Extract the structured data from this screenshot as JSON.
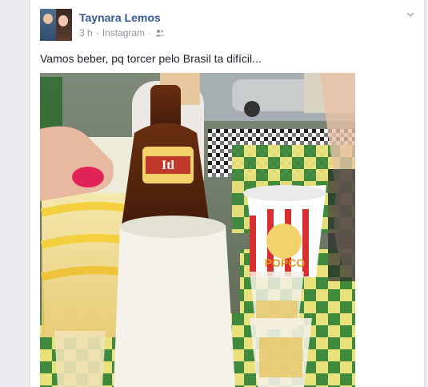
{
  "post": {
    "author": "Taynara Lemos",
    "time": "3 h",
    "separator": "·",
    "source": "Instagram",
    "text": "Vamos beber, pq torcer pelo Brasil ta difícil...",
    "audience_icon": "friends-icon",
    "menu_icon": "chevron-down-icon"
  },
  "photo": {
    "beer_label": "Itl",
    "cup_label": "POPCO"
  },
  "colors": {
    "author_link": "#365899",
    "meta": "#90949c",
    "text": "#1d2129",
    "background": "#e9ebee"
  }
}
